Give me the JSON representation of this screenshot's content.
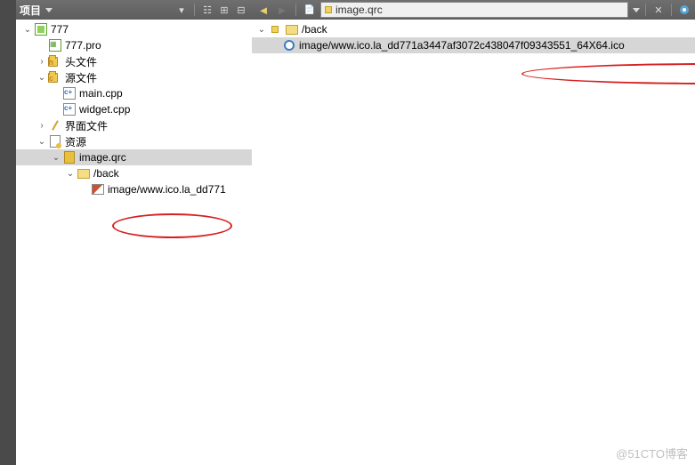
{
  "left": {
    "title": "项目",
    "toolbar": {
      "filter": "▾",
      "layout": "☷",
      "add": "⊞",
      "collapse": "⊟"
    },
    "tree": [
      {
        "depth": 0,
        "chev": "down",
        "icon": "proj",
        "label": "777"
      },
      {
        "depth": 1,
        "chev": "none",
        "icon": "pro",
        "label": "777.pro"
      },
      {
        "depth": 1,
        "chev": "right",
        "icon": "folder-h",
        "iconBadge": "h",
        "label": "头文件"
      },
      {
        "depth": 1,
        "chev": "down",
        "icon": "folder-h",
        "iconBadge": "c",
        "label": "源文件"
      },
      {
        "depth": 2,
        "chev": "none",
        "icon": "cpp",
        "label": "main.cpp"
      },
      {
        "depth": 2,
        "chev": "none",
        "icon": "cpp",
        "label": "widget.cpp"
      },
      {
        "depth": 1,
        "chev": "right",
        "icon": "pencil",
        "label": "界面文件"
      },
      {
        "depth": 1,
        "chev": "down",
        "icon": "res",
        "label": "资源"
      },
      {
        "depth": 2,
        "chev": "down",
        "icon": "qrc",
        "label": "image.qrc",
        "selected": true
      },
      {
        "depth": 3,
        "chev": "down",
        "icon": "folder",
        "label": "/back"
      },
      {
        "depth": 4,
        "chev": "none",
        "icon": "img",
        "label": "image/www.ico.la_dd771"
      }
    ]
  },
  "right": {
    "breadcrumb": {
      "back": "◄",
      "forward": "►",
      "lock": "🔒",
      "path": "image.qrc",
      "close": "✕",
      "debug": "🐞"
    },
    "tree": [
      {
        "depth": 0,
        "chev": "down",
        "icon": "folder",
        "lock": true,
        "label": "/back"
      },
      {
        "depth": 1,
        "chev": "none",
        "icon": "circle",
        "label": "image/www.ico.la_dd771a3447af3072c438047f09343551_64X64.ico",
        "selected": true
      }
    ]
  },
  "watermark": "51CTO博客"
}
